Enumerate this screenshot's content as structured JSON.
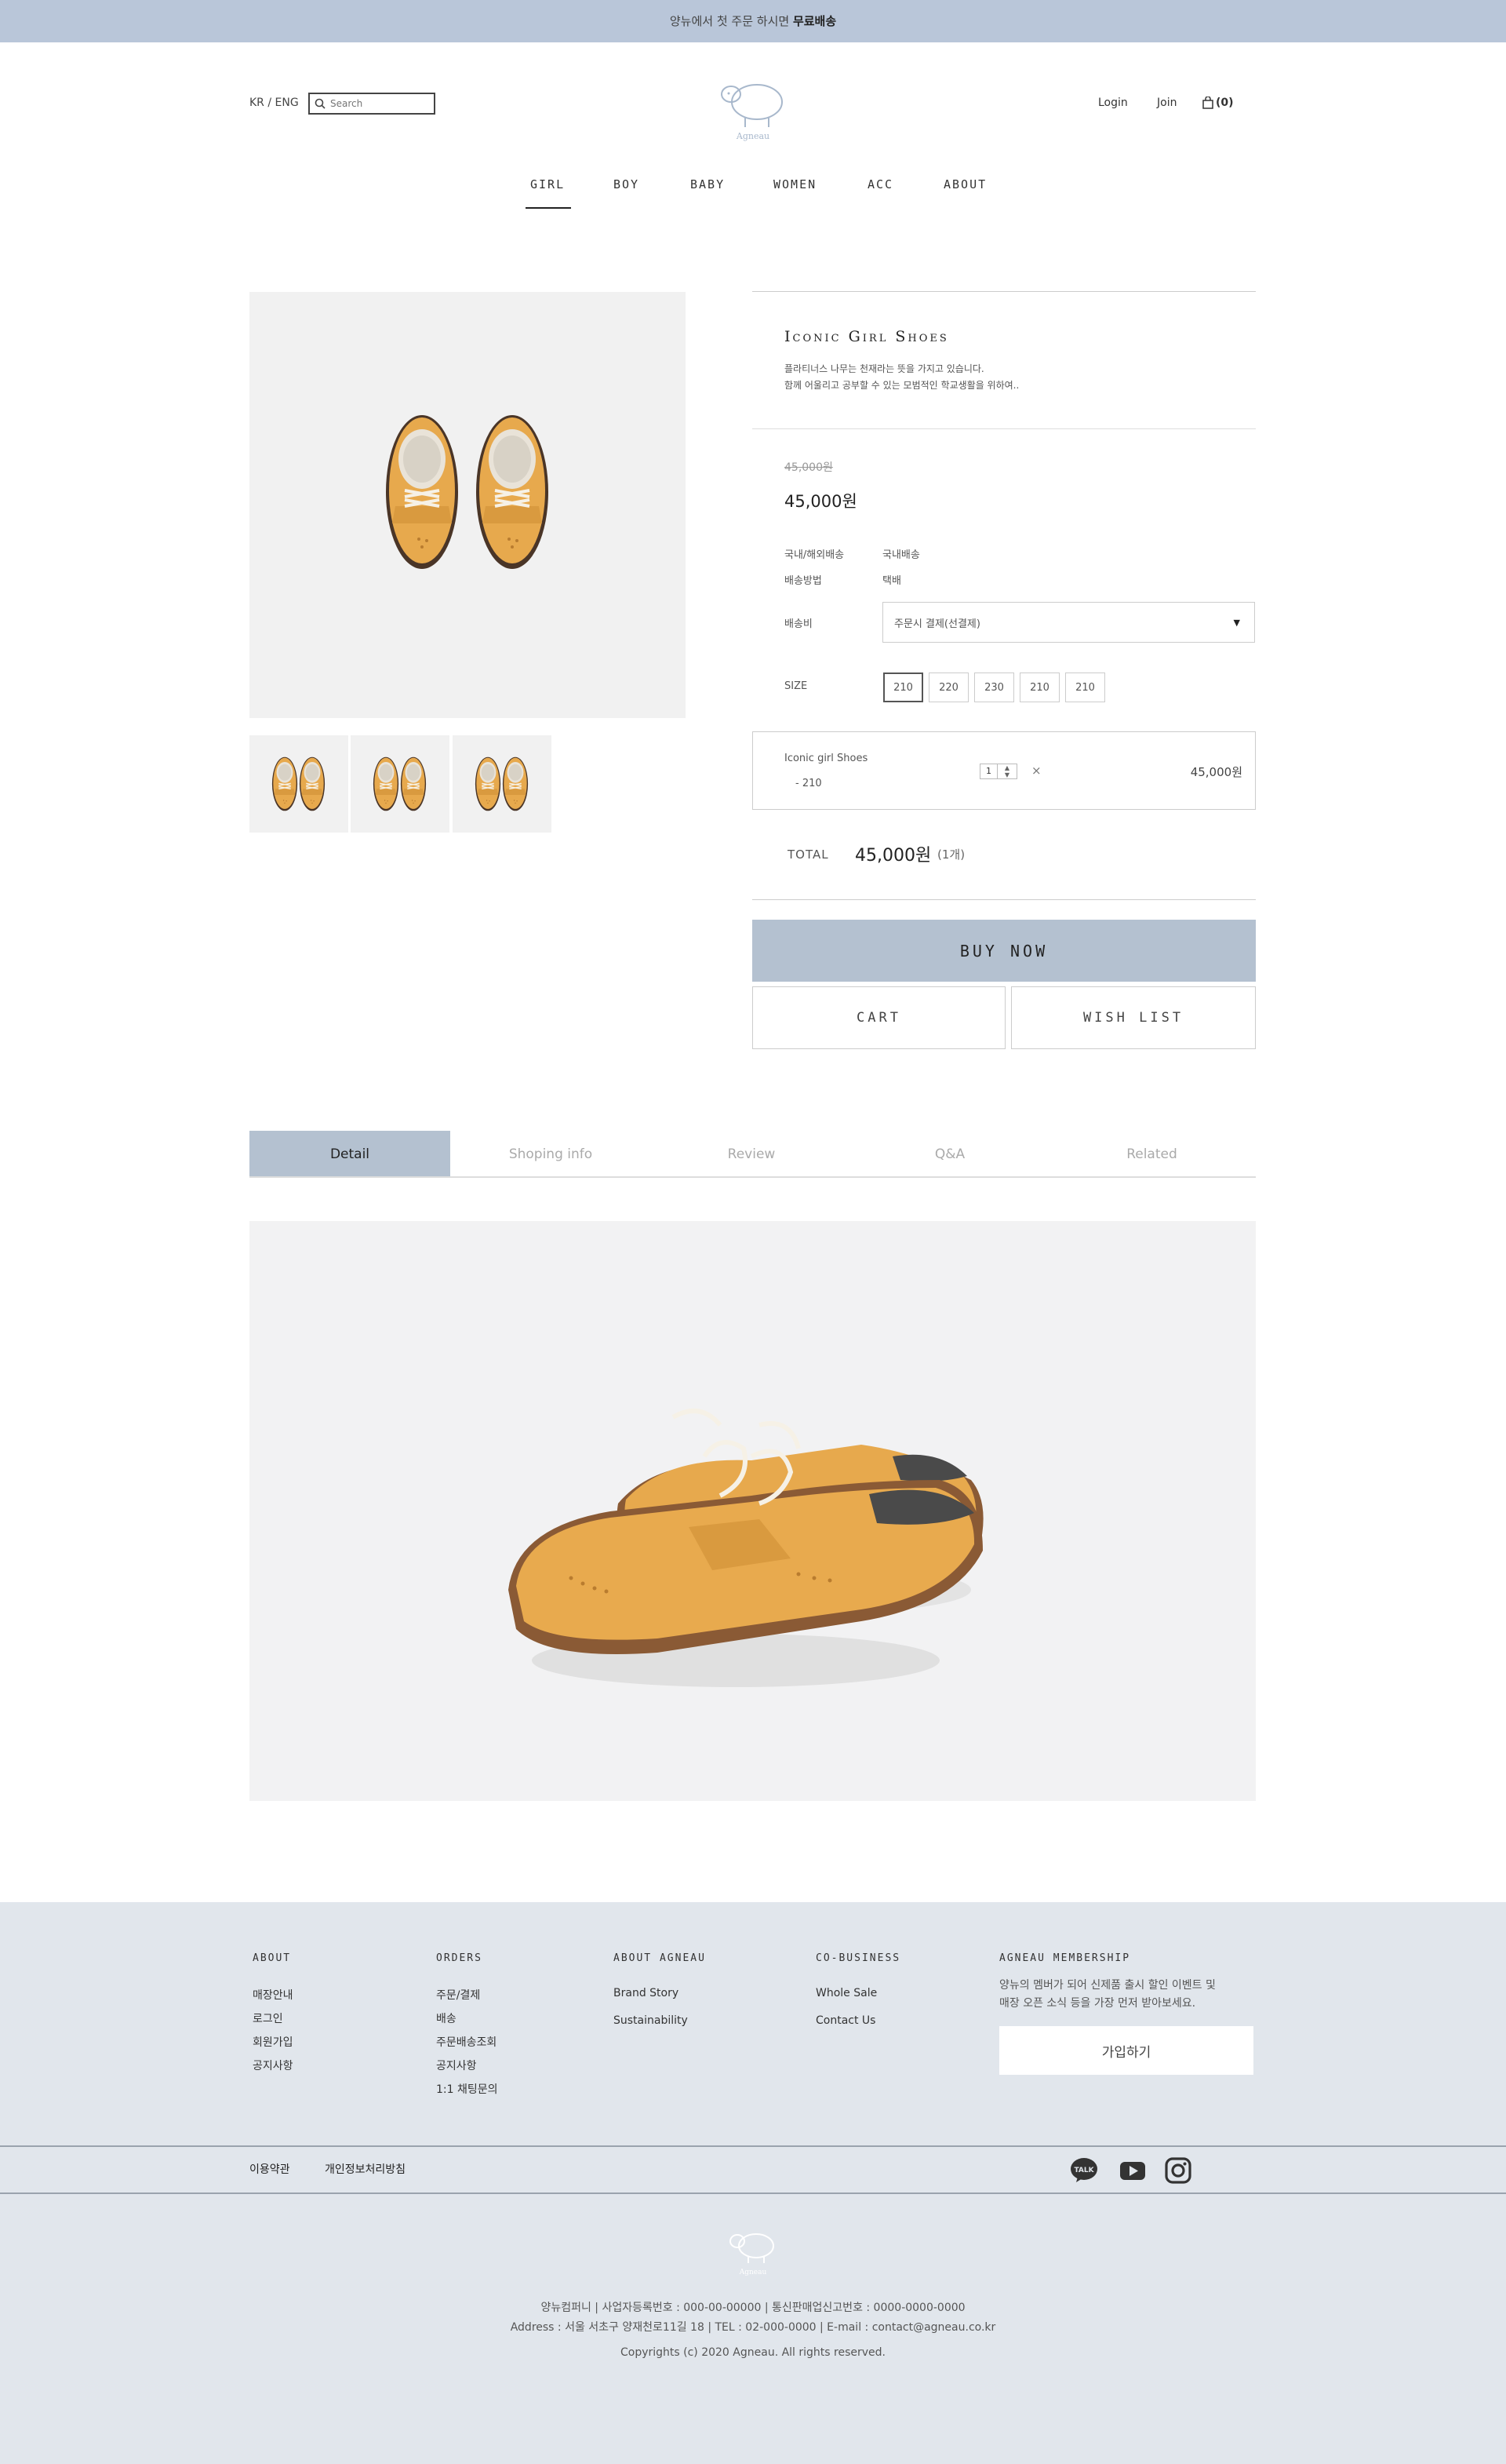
{
  "banner": {
    "text": "양뉴에서 첫 주문 하시면 ",
    "bold": "무료배송"
  },
  "header": {
    "lang": "KR / ENG",
    "search_placeholder": "Search",
    "login": "Login",
    "join": "Join",
    "cart_count": "(0)",
    "logo_text": "Agneau"
  },
  "nav": [
    "GIRL",
    "BOY",
    "BABY",
    "WOMEN",
    "ACC",
    "ABOUT"
  ],
  "product": {
    "title": "Iconic Girl Shoes",
    "desc1": "플라티너스 나무는 천재라는 뜻을 가지고 있습니다.",
    "desc2": "함께 어울리고 공부할 수 있는 모범적인 학교생활을 위하여..",
    "old_price": "45,000원",
    "price": "45,000원",
    "ship_type_label": "국내/해외배송",
    "ship_type_value": "국내배송",
    "ship_method_label": "배송방법",
    "ship_method_value": "택배",
    "ship_fee_label": "배송비",
    "ship_fee_select": "주문시 결제(선결제)",
    "size_label": "SIZE",
    "sizes": [
      "210",
      "220",
      "230",
      "210",
      "210"
    ]
  },
  "option": {
    "name": "Iconic girl Shoes",
    "size": "- 210",
    "qty": "1",
    "remove": "×",
    "price": "45,000원"
  },
  "total": {
    "label": "TOTAL",
    "value": "45,000원",
    "count": "(1개)"
  },
  "buttons": {
    "buy": "BUY NOW",
    "cart": "CART",
    "wish": "WISH LIST"
  },
  "tabs": [
    "Detail",
    "Shoping info",
    "Review",
    "Q&A",
    "Related"
  ],
  "footer": {
    "about": {
      "title": "ABOUT",
      "links": [
        "매장안내",
        "로그인",
        "회원가입",
        "공지사항"
      ]
    },
    "orders": {
      "title": "ORDERS",
      "links": [
        "주문/결제",
        "배송",
        "주문배송조회",
        "공지사항",
        "1:1 채팅문의"
      ]
    },
    "about_agneau": {
      "title": "ABOUT AGNEAU",
      "links": [
        "Brand Story",
        "Sustainability"
      ]
    },
    "co_business": {
      "title": "CO-BUSINESS",
      "links": [
        "Whole Sale",
        "Contact Us"
      ]
    },
    "membership": {
      "title": "AGNEAU MEMBERSHIP",
      "desc1": "양뉴의 멤버가 되어 신제품 출시 할인 이벤트 및",
      "desc2": "매장 오픈 소식 등을 가장 먼저 받아보세요.",
      "button": "가입하기"
    },
    "terms": "이용약관",
    "privacy": "개인정보처리방침",
    "logo_text": "Agneau",
    "info1": "양뉴컴퍼니   |   사업자등록번호 : 000-00-00000   |   통신판매업신고번호 : 0000-0000-0000",
    "info2": "Address : 서울 서초구 양재천로11길 18   |   TEL : 02-000-0000   |   E-mail : contact@agneau.co.kr",
    "copyright": "Copyrights (c) 2020 Agneau. All rights reserved.",
    "talk_label": "TALK"
  },
  "icons": {
    "search": "search-icon",
    "cart": "shopping-bag-icon",
    "dropdown": "triangle-down-icon",
    "kakao": "kakao-talk-icon",
    "youtube": "youtube-icon",
    "instagram": "instagram-icon"
  },
  "colors": {
    "banner": "#b9c6d9",
    "accent": "#b4c1d0",
    "footer": "#e1e6ec",
    "shoe": "#e7a94d"
  }
}
